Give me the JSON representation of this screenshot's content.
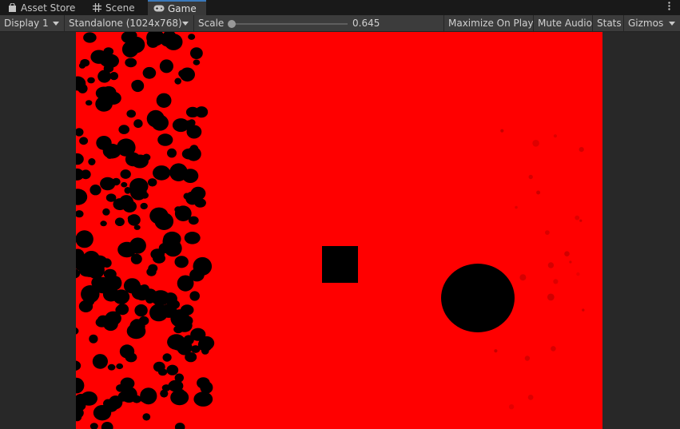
{
  "tabs": {
    "asset_store": "Asset Store",
    "scene": "Scene",
    "game": "Game"
  },
  "toolbar": {
    "display": "Display 1",
    "resolution": "Standalone (1024x768)",
    "scale_label": "Scale",
    "scale_value": "0.645",
    "maximize": "Maximize On Play",
    "mute": "Mute Audio",
    "stats": "Stats",
    "gizmos": "Gizmos"
  },
  "icons": {
    "asset_store": "shopping-bag-icon",
    "scene": "grid-icon",
    "game": "gamepad-icon",
    "more": "more-vertical-icon"
  },
  "colors": {
    "game_background": "#ff0000",
    "game_objects": "#000000",
    "active_tab_accent": "#3a79bb"
  }
}
